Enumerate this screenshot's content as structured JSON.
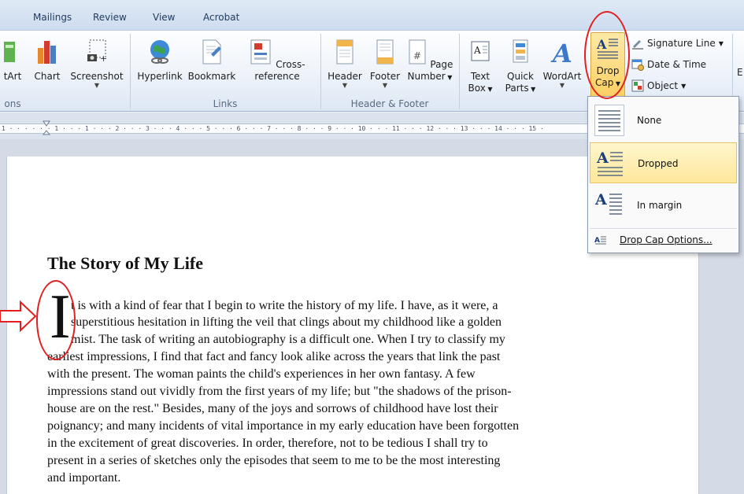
{
  "tabs": [
    "Mailings",
    "Review",
    "View",
    "Acrobat"
  ],
  "ribbon": {
    "groups": {
      "left_partial": "ons",
      "links": "Links",
      "header_footer": "Header & Footer"
    },
    "buttons": {
      "smartart_partial": "tArt",
      "chart": "Chart",
      "screenshot": "Screenshot",
      "hyperlink": "Hyperlink",
      "bookmark": "Bookmark",
      "cross_reference": "Cross-reference",
      "header": "Header",
      "footer": "Footer",
      "page_number_1": "Page",
      "page_number_2": "Number",
      "text_box_1": "Text",
      "text_box_2": "Box",
      "quick_parts_1": "Quick",
      "quick_parts_2": "Parts",
      "wordart": "WordArt",
      "drop_cap_1": "Drop",
      "drop_cap_2": "Cap",
      "signature_line": "Signature Line",
      "date_time": "Date & Time",
      "object": "Object",
      "edge_partial": "E"
    }
  },
  "ruler": {
    "ticks": "1 · · ·   · · · 1 · · · 1 · · · 2 · · · 3 · · · 4 · · · 5 · · · 6 · · · 7 · · · 8 · · · 9 · · · 10 · · · 11 · · · 12 · · · 13 · · · 14 · · · 15 ·"
  },
  "document": {
    "title": "The Story of My Life",
    "dropcap": "I",
    "lines": [
      "t is with a kind of fear that I begin to write the history of my life. I have, as it were, a",
      "superstitious hesitation in lifting the veil that clings about my childhood like a golden",
      "mist. The task of writing an autobiography is a difficult one. When I try to classify my",
      "earliest impressions,  I find that fact and fancy look alike across the years that link the past",
      "with the present. The woman paints the child's experiences in her own fantasy. A few",
      "impressions  stand out vividly from the first years of my life; but \"the shadows of the prison-",
      "house are on the rest.\" Besides, many of the joys and sorrows of childhood have lost their",
      "poignancy; and many incidents of vital importance in my early education have been forgotten",
      "in the excitement of great discoveries. In order, therefore, not to be tedious I shall try to",
      "present in a series of sketches only the episodes that seem to me to be the most interesting",
      "and important."
    ]
  },
  "dropcap_menu": {
    "none": "None",
    "dropped": "Dropped",
    "in_margin": "In margin",
    "options": "Drop Cap Options..."
  },
  "colors": {
    "accent_red": "#e02020",
    "highlight": "#fde79b"
  }
}
